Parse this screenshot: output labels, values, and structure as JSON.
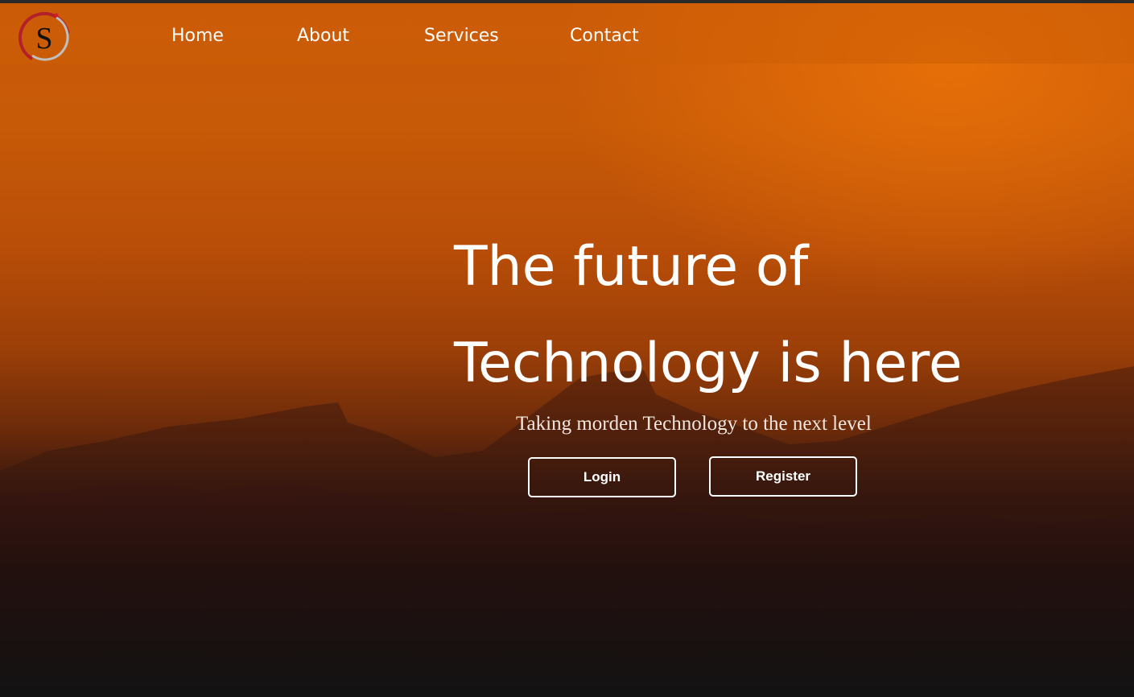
{
  "brand": {
    "logo_letter": "S",
    "colors": {
      "logo_ring": "#b3202a",
      "logo_silver": "#bfbfbf",
      "logo_letter": "#111111"
    }
  },
  "nav": {
    "items": [
      {
        "label": "Home"
      },
      {
        "label": "About"
      },
      {
        "label": "Services"
      },
      {
        "label": "Contact"
      }
    ]
  },
  "hero": {
    "title_line1": "The future of",
    "title_line2": "Technology is here",
    "subtitle": "Taking morden Technology to the next level",
    "login_label": "Login",
    "register_label": "Register"
  },
  "colors": {
    "accent_orange": "#d8680a",
    "dark_bottom": "#121212",
    "text": "#ffffff"
  }
}
